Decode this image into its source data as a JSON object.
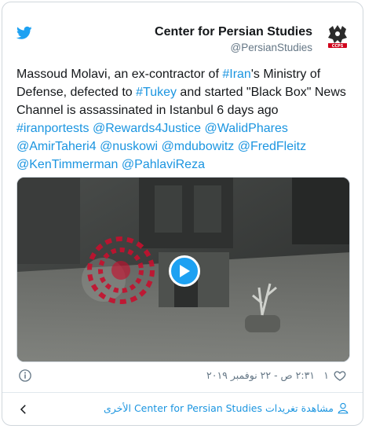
{
  "author": {
    "name": "Center for Persian Studies",
    "handle": "@PersianStudies",
    "avatar_text": "CCPS"
  },
  "tweet": {
    "segments": [
      {
        "text": "Massoud Molavi, an ex-contractor of ",
        "link": false
      },
      {
        "text": "#Iran",
        "link": true
      },
      {
        "text": "'s Ministry of Defense, defected to ",
        "link": false
      },
      {
        "text": "#Tukey",
        "link": true
      },
      {
        "text": " and started \"Black Box\" News Channel is assassinated in Istanbul 6 days ago ",
        "link": false
      },
      {
        "text": "#iranportests",
        "link": true
      },
      {
        "text": " ",
        "link": false
      },
      {
        "text": "@Rewards4Justice",
        "link": true
      },
      {
        "text": " ",
        "link": false
      },
      {
        "text": "@WalidPhares",
        "link": true
      },
      {
        "text": " ",
        "link": false
      },
      {
        "text": "@AmirTaheri4",
        "link": true
      },
      {
        "text": " ",
        "link": false
      },
      {
        "text": "@nuskowi",
        "link": true
      },
      {
        "text": " ",
        "link": false
      },
      {
        "text": "@mdubowitz",
        "link": true
      },
      {
        "text": " ",
        "link": false
      },
      {
        "text": "@FredFleitz",
        "link": true
      },
      {
        "text": " ",
        "link": false
      },
      {
        "text": "@KenTimmerman",
        "link": true
      },
      {
        "text": " ",
        "link": false
      },
      {
        "text": "@PahlaviReza",
        "link": true
      }
    ]
  },
  "media": {
    "type": "video",
    "play_icon": "play-icon",
    "watermark_icon": "broadcaster-logo-icon"
  },
  "meta": {
    "likes": "١",
    "timestamp": "٢:٣١ ص - ٢٢ نوفمبر ٢٠١٩",
    "heart_icon": "heart-icon",
    "info_icon": "info-icon"
  },
  "footer": {
    "more_text": "مشاهدة تغريدات Center for Persian Studies الأخرى",
    "person_icon": "person-icon",
    "chevron_icon": "chevron-left-icon"
  },
  "colors": {
    "link": "#1b95e0",
    "brand": "#1da1f2",
    "muted": "#657786",
    "text": "#14171a"
  }
}
